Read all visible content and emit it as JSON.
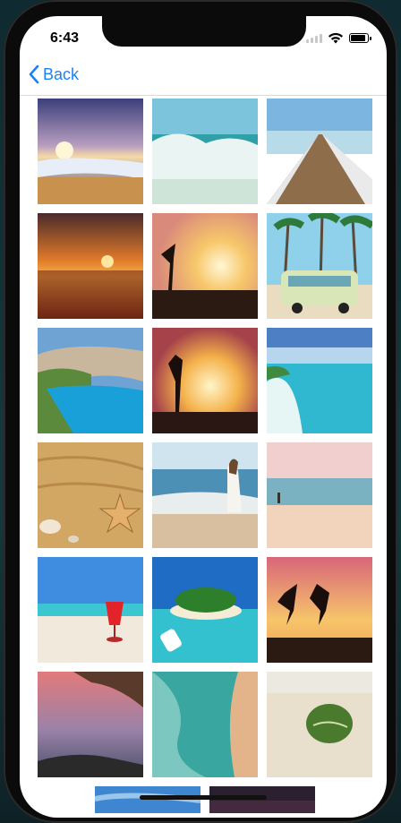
{
  "status": {
    "time": "6:43"
  },
  "nav": {
    "back_label": "Back"
  },
  "photos": [
    "beach-sunset-waves",
    "ocean-wave-foam",
    "wooden-pier",
    "orange-sea-sunset",
    "silhouette-sunset",
    "van-palm-trees",
    "cliff-cove-bay",
    "silhouette-sun-glow",
    "aerial-turquoise-coast",
    "sand-starfish-shells",
    "woman-walking-beach",
    "pastel-beach-person",
    "red-cocktail-beach",
    "tropical-island-boat",
    "jumping-silhouettes",
    "pink-sky-rocks",
    "aerial-shore-water",
    "leaf-on-sand",
    "partial-beach-sky",
    "partial-dark-sunset"
  ]
}
